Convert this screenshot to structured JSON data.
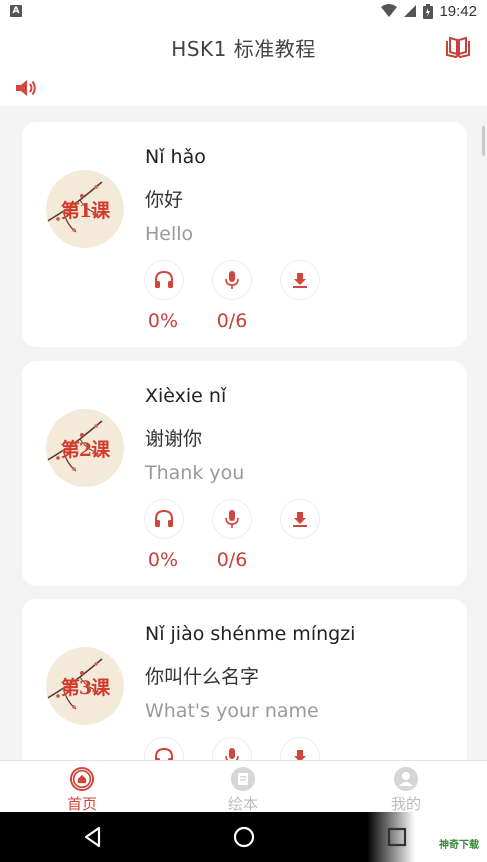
{
  "status_bar": {
    "left_badge": "A",
    "time": "19:42"
  },
  "header": {
    "title": "HSK1 标准教程",
    "book_icon": "book-open-icon"
  },
  "audio": {
    "icon": "speaker-icon"
  },
  "lessons": [
    {
      "badge": "第1课",
      "pinyin": "Nǐ hǎo",
      "hanzi": "你好",
      "english": "Hello",
      "listen_progress": "0%",
      "record_progress": "0/6"
    },
    {
      "badge": "第2课",
      "pinyin": "Xièxie nǐ",
      "hanzi": "谢谢你",
      "english": "Thank you",
      "listen_progress": "0%",
      "record_progress": "0/6"
    },
    {
      "badge": "第3课",
      "pinyin": "Nǐ jiào shénme míngzi",
      "hanzi": "你叫什么名字",
      "english": "What's your name",
      "listen_progress": "",
      "record_progress": ""
    }
  ],
  "tabs": [
    {
      "label": "首页",
      "icon": "home-icon",
      "active": true
    },
    {
      "label": "绘本",
      "icon": "picture-book-icon",
      "active": false
    },
    {
      "label": "我的",
      "icon": "profile-icon",
      "active": false
    }
  ],
  "watermark": {
    "text": "神奇下载"
  },
  "colors": {
    "accent": "#d0463c",
    "badge_text": "#d23a2a",
    "background": "#f3f3f3"
  }
}
